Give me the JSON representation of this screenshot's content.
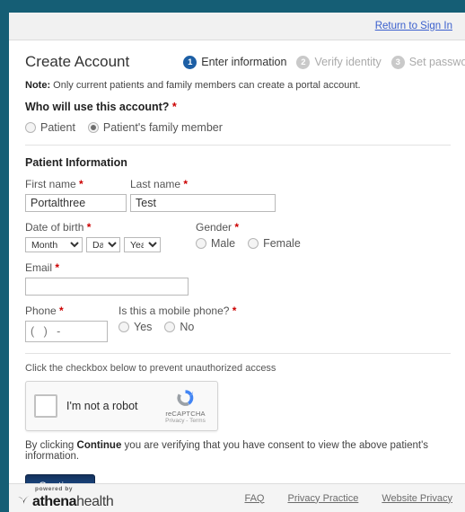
{
  "frame": {
    "accent_teal": "#155e75"
  },
  "topbar": {
    "return_link": "Return to Sign In"
  },
  "header": {
    "title": "Create Account",
    "steps": [
      {
        "number": "1",
        "label": "Enter information",
        "state": "active"
      },
      {
        "number": "2",
        "label": "Verify identity",
        "state": "inactive"
      },
      {
        "number": "3",
        "label": "Set password",
        "state": "inactive"
      }
    ],
    "active_color": "#1d5fa5",
    "inactive_color": "#c9c9c9"
  },
  "note": {
    "prefix": "Note:",
    "text": " Only current patients and family members can create a portal account."
  },
  "account_user": {
    "question": "Who will use this account?",
    "required_mark": "*",
    "options": [
      {
        "label": "Patient",
        "selected": false
      },
      {
        "label": "Patient's family member",
        "selected": true
      }
    ]
  },
  "patient_information": {
    "section_title": "Patient Information",
    "first_name": {
      "label": "First name",
      "value": "Portalthree",
      "placeholder": ""
    },
    "last_name": {
      "label": "Last name",
      "value": "Test",
      "placeholder": ""
    },
    "date_of_birth": {
      "label": "Date of birth",
      "month": "Month",
      "day": "Day",
      "year": "Year"
    },
    "gender": {
      "label": "Gender",
      "options": [
        {
          "label": "Male",
          "selected": false
        },
        {
          "label": "Female",
          "selected": false
        }
      ]
    },
    "email": {
      "label": "Email",
      "value": "",
      "placeholder": ""
    },
    "phone": {
      "label": "Phone",
      "value": "",
      "placeholder": "(   )   -"
    },
    "mobile": {
      "label": "Is this a mobile phone?",
      "options": [
        {
          "label": "Yes",
          "selected": false
        },
        {
          "label": "No",
          "selected": false
        }
      ]
    }
  },
  "captcha": {
    "instruction": "Click the checkbox below to prevent unauthorized access",
    "checkbox_label": "I'm not a robot",
    "brand_name": "reCAPTCHA",
    "brand_terms": "Privacy - Terms",
    "checked": false
  },
  "consent": {
    "prefix": "By clicking ",
    "bold": "Continue",
    "suffix": " you are verifying that you have consent to view the above patient's information."
  },
  "actions": {
    "continue_label": "Continue"
  },
  "footer": {
    "powered_by": "powered by",
    "brand_bold": "athena",
    "brand_light": "health",
    "links": [
      {
        "label": "FAQ"
      },
      {
        "label": "Privacy Practice"
      },
      {
        "label": "Website Privacy"
      }
    ]
  }
}
